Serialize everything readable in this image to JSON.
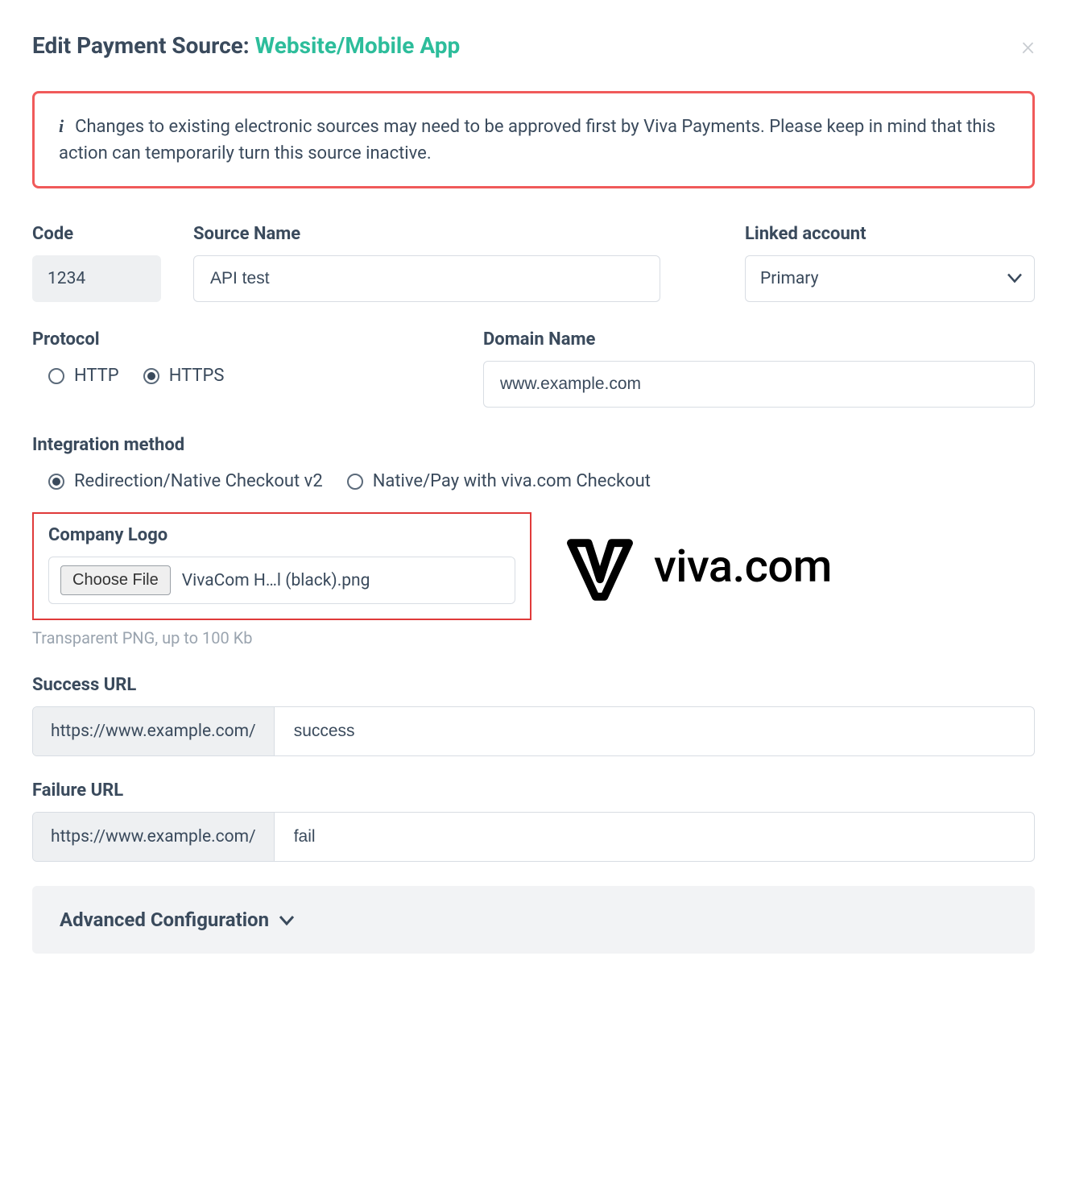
{
  "header": {
    "title_prefix": "Edit Payment Source: ",
    "title_highlight": "Website/Mobile App"
  },
  "alert": {
    "text": "Changes to existing electronic sources may need to be approved first by Viva Payments. Please keep in mind that this action can temporarily turn this source inactive."
  },
  "fields": {
    "code": {
      "label": "Code",
      "value": "1234"
    },
    "source_name": {
      "label": "Source Name",
      "value": "API test"
    },
    "linked_account": {
      "label": "Linked account",
      "value": "Primary"
    },
    "protocol": {
      "label": "Protocol",
      "options": [
        {
          "label": "HTTP",
          "checked": false
        },
        {
          "label": "HTTPS",
          "checked": true
        }
      ]
    },
    "domain": {
      "label": "Domain Name",
      "value": "www.example.com"
    },
    "integration": {
      "label": "Integration method",
      "options": [
        {
          "label": "Redirection/Native Checkout v2",
          "checked": true
        },
        {
          "label": "Native/Pay with viva.com Checkout",
          "checked": false
        }
      ]
    },
    "company_logo": {
      "label": "Company Logo",
      "button": "Choose File",
      "filename": "VivaCom H…l (black).png",
      "hint": "Transparent PNG, up to 100 Kb",
      "preview_text": "viva.com"
    },
    "success_url": {
      "label": "Success URL",
      "prefix": "https://www.example.com/",
      "value": "success"
    },
    "failure_url": {
      "label": "Failure URL",
      "prefix": "https://www.example.com/",
      "value": "fail"
    },
    "advanced": {
      "label": "Advanced Configuration"
    }
  }
}
